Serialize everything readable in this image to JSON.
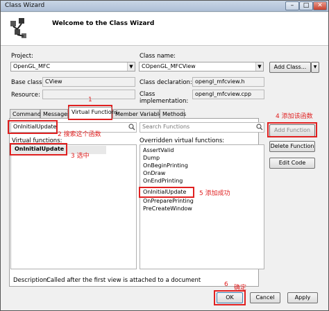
{
  "window": {
    "title": "Class Wizard"
  },
  "header": {
    "welcome": "Welcome to the Class Wizard"
  },
  "project": {
    "label": "Project:",
    "value": "OpenGL_MFC"
  },
  "class_name": {
    "label": "Class name:",
    "value": "COpenGL_MFCView"
  },
  "add_class_button": "Add Class...",
  "base_class": {
    "label": "Base class:",
    "value": "CView"
  },
  "class_declaration": {
    "label": "Class declaration:",
    "value": "opengl_mfcview.h"
  },
  "resource": {
    "label": "Resource:",
    "value": ""
  },
  "class_implementation": {
    "label": "Class implementation:",
    "value": "opengl_mfcview.cpp"
  },
  "tabs": [
    "Commands",
    "Messages",
    "Virtual Functions",
    "Member Variables",
    "Methods"
  ],
  "search_left": {
    "value": "OnInitialUpdate"
  },
  "search_right": {
    "placeholder": "Search Functions"
  },
  "virtual_functions": {
    "label": "Virtual functions:",
    "items": [
      "OnInitialUpdate"
    ]
  },
  "overridden": {
    "label": "Overridden virtual functions:",
    "items": [
      "AssertValid",
      "Dump",
      "OnBeginPrinting",
      "OnDraw",
      "OnEndPrinting",
      "OnInitialUpdate",
      "OnPreparePrinting",
      "PreCreateWindow"
    ]
  },
  "side_buttons": {
    "add": "Add Function",
    "delete": "Delete Function",
    "edit": "Edit Code"
  },
  "description": {
    "label": "Description:",
    "text": "Called after the first view is attached to a document"
  },
  "footer_buttons": {
    "ok": "OK",
    "cancel": "Cancel",
    "apply": "Apply"
  },
  "annotations": {
    "n1": "1",
    "n2": "2 搜索这个函数",
    "n3": "3  选中",
    "n4": "4  添加该函数",
    "n5": "5   添加成功",
    "n6": "6",
    "n6_label": "确定"
  },
  "colors": {
    "annotation": "#e02020",
    "selection": "#3399ff"
  }
}
